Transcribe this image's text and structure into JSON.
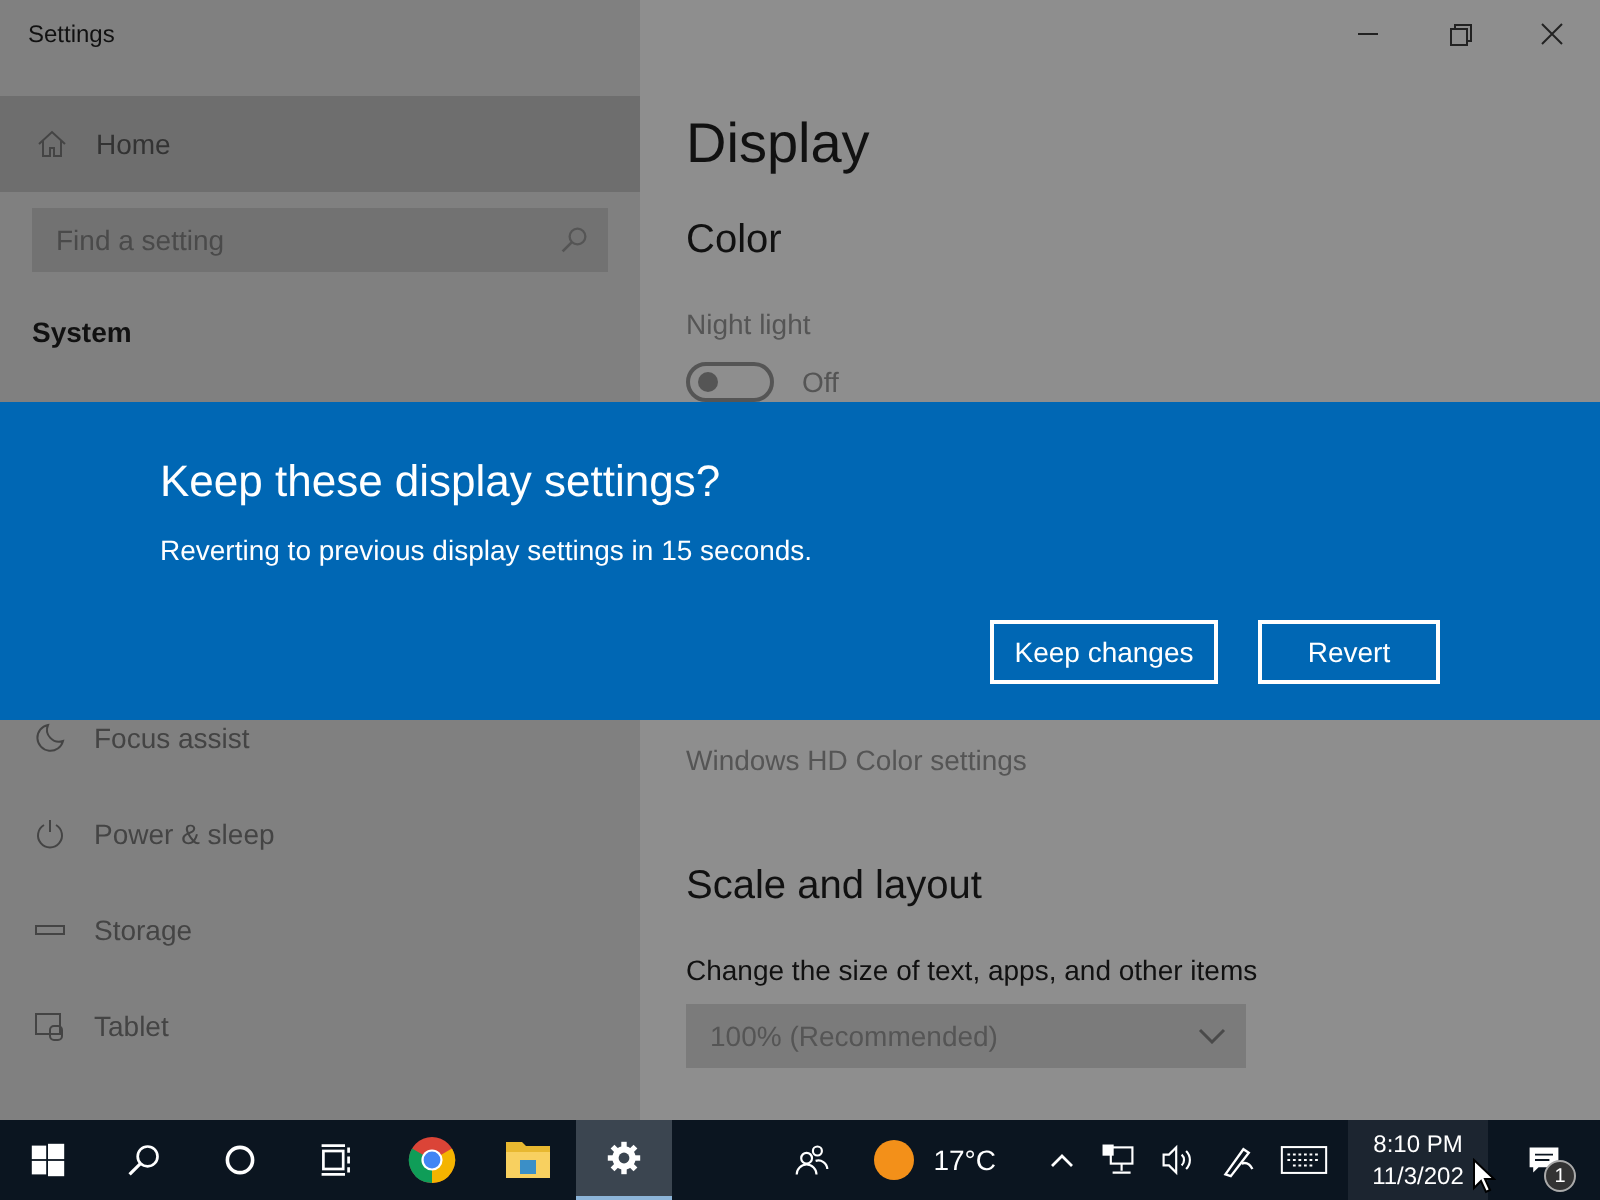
{
  "window": {
    "title": "Settings"
  },
  "sidebar": {
    "home": {
      "label": "Home",
      "selected": true
    },
    "search": {
      "placeholder": "Find a setting"
    },
    "section": "System",
    "items": [
      {
        "label": "Focus assist",
        "kind": "moon"
      },
      {
        "label": "Power & sleep",
        "kind": "power"
      },
      {
        "label": "Storage",
        "kind": "storage"
      },
      {
        "label": "Tablet",
        "kind": "tablet"
      }
    ]
  },
  "content": {
    "title": "Display",
    "color_heading": "Color",
    "night_light": {
      "label": "Night light",
      "on": false,
      "state": "Off"
    },
    "hdr_link": "Windows HD Color settings",
    "scale_heading": "Scale and layout",
    "scale_label": "Change the size of text, apps, and other items",
    "scale_value": "100% (Recommended)"
  },
  "dialog": {
    "title": "Keep these display settings?",
    "message": "Reverting to previous display settings in 15 seconds.",
    "buttons": [
      "Keep changes",
      "Revert"
    ]
  },
  "taskbar": {
    "apps": [
      {
        "kind": "start",
        "selected": false
      },
      {
        "kind": "search",
        "selected": false
      },
      {
        "kind": "cortana",
        "selected": false
      },
      {
        "kind": "taskview",
        "selected": false
      },
      {
        "kind": "chrome",
        "selected": false
      },
      {
        "kind": "explorer",
        "selected": false
      },
      {
        "kind": "settings",
        "selected": true
      }
    ],
    "temperature": "17°C",
    "time": "8:10 PM",
    "date": "11/3/202",
    "notifications": "1"
  }
}
